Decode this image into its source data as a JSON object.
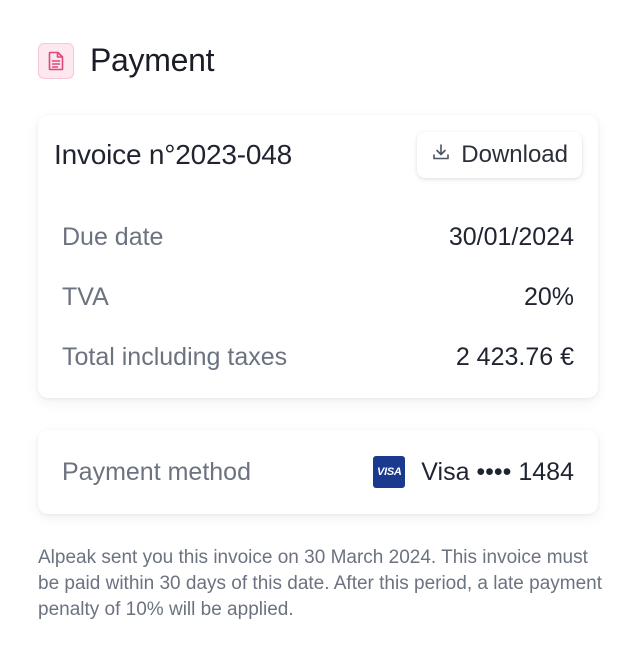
{
  "header": {
    "title": "Payment",
    "icon": "document-icon",
    "accent": "#e0457b"
  },
  "invoice": {
    "title": "Invoice n°2023-048",
    "download_label": "Download",
    "rows": [
      {
        "label": "Due date",
        "value": "30/01/2024"
      },
      {
        "label": "TVA",
        "value": "20%"
      },
      {
        "label": "Total including taxes",
        "value": "2 423.76 €"
      }
    ]
  },
  "payment_method": {
    "label": "Payment method",
    "card_brand_logo": "VISA",
    "card_text": "Visa •••• 1484"
  },
  "note": "Alpeak sent you this invoice on 30 March 2024. This invoice must be paid within 30 days of this date. After this period, a late payment penalty of 10% will be applied."
}
